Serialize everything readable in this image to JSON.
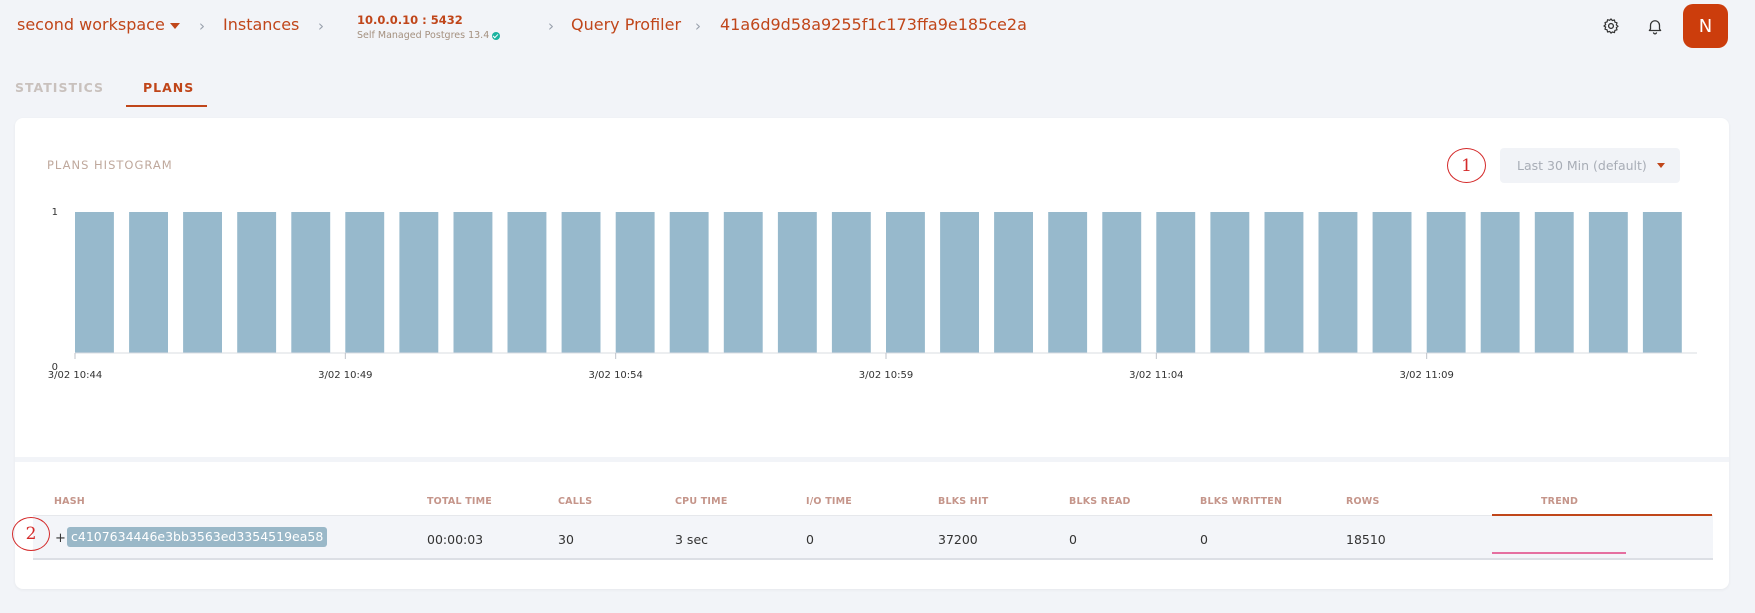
{
  "header": {
    "workspace": "second workspace",
    "instances": "Instances",
    "instance_host": "10.0.0.10 : 5432",
    "instance_sub": "Self Managed Postgres 13.4",
    "profiler": "Query Profiler",
    "query_id": "41a6d9d58a9255f1c173ffa9e185ce2a",
    "avatar_initial": "N"
  },
  "tabs": [
    {
      "label": "STATISTICS",
      "active": false
    },
    {
      "label": "PLANS",
      "active": true
    }
  ],
  "histogram": {
    "title": "PLANS HISTOGRAM",
    "range_label": "Last 30 Min (default)",
    "annotation_1": "1"
  },
  "chart_data": {
    "type": "bar",
    "bar_color": "#97b9cc",
    "ylim": [
      0,
      1
    ],
    "yticks": [
      "0",
      "1"
    ],
    "xticks": [
      "3/02 10:44",
      "3/02 10:49",
      "3/02 10:54",
      "3/02 10:59",
      "3/02 11:04",
      "3/02 11:09"
    ],
    "values": [
      1,
      1,
      1,
      1,
      1,
      1,
      1,
      1,
      1,
      1,
      1,
      1,
      1,
      1,
      1,
      1,
      1,
      1,
      1,
      1,
      1,
      1,
      1,
      1,
      1,
      1,
      1,
      1,
      1,
      1
    ]
  },
  "table": {
    "columns": [
      "HASH",
      "TOTAL TIME",
      "CALLS",
      "CPU TIME",
      "I/O TIME",
      "BLKS HIT",
      "BLKS READ",
      "BLKS WRITTEN",
      "ROWS",
      "TREND"
    ],
    "row": {
      "annotation_2": "2",
      "expand": "+",
      "hash": "c4107634446e3bb3563ed3354519ea58",
      "total_time": "00:00:03",
      "calls": "30",
      "cpu_time": "3 sec",
      "io_time": "0",
      "blks_hit": "37200",
      "blks_read": "0",
      "blks_written": "0",
      "rows": "18510"
    }
  },
  "colors": {
    "accent": "#c0461a",
    "avatar": "#cc3d0c",
    "trend": "#e56fa0"
  }
}
